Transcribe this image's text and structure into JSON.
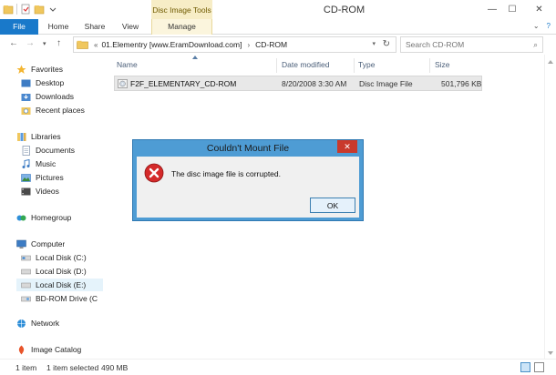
{
  "window": {
    "title": "CD-ROM",
    "context_tools": "Disc Image Tools",
    "minimize": "—",
    "maximize": "☐",
    "close": "✕"
  },
  "ribbon": {
    "tabs": {
      "file": "File",
      "home": "Home",
      "share": "Share",
      "view": "View",
      "manage": "Manage"
    }
  },
  "address": {
    "overflow": "«",
    "crumbs": [
      "01.Elementry [www.EramDownload.com]",
      "CD-ROM"
    ],
    "search_placeholder": "Search CD-ROM"
  },
  "nav": {
    "favorites": "Favorites",
    "desktop": "Desktop",
    "downloads": "Downloads",
    "recent": "Recent places",
    "libraries": "Libraries",
    "documents": "Documents",
    "music": "Music",
    "pictures": "Pictures",
    "videos": "Videos",
    "homegroup": "Homegroup",
    "computer": "Computer",
    "disk_c": "Local Disk (C:)",
    "disk_d": "Local Disk (D:)",
    "disk_e": "Local Disk (E:)",
    "bd_rom": "BD-ROM Drive (C",
    "network": "Network",
    "image_catalog": "Image Catalog"
  },
  "columns": {
    "name": "Name",
    "date": "Date modified",
    "type": "Type",
    "size": "Size"
  },
  "files": [
    {
      "name": "F2F_ELEMENTARY_CD-ROM",
      "date": "8/20/2008 3:30 AM",
      "type": "Disc Image File",
      "size": "501,796 KB"
    }
  ],
  "status": {
    "count": "1 item",
    "selected": "1 item selected",
    "size": "490 MB"
  },
  "dialog": {
    "title": "Couldn't Mount File",
    "message": "The disc image file is corrupted.",
    "ok": "OK",
    "close": "✕"
  },
  "colors": {
    "accent": "#1979ca",
    "dialog_frame": "#4e9cd4",
    "error": "#d42a2a"
  }
}
